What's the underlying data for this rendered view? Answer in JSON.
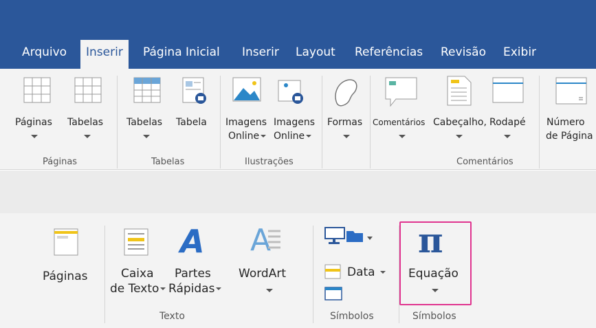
{
  "tabs": [
    {
      "label": "Arquivo",
      "active": false
    },
    {
      "label": "Inserir",
      "active": true
    },
    {
      "label": "Página Inicial",
      "active": false
    },
    {
      "label": "Inserir",
      "active": false
    },
    {
      "label": "Layout",
      "active": false
    },
    {
      "label": "Referências",
      "active": false
    },
    {
      "label": "Revisão",
      "active": false
    },
    {
      "label": "Exibir",
      "active": false
    }
  ],
  "ribbon1": {
    "buttons": [
      {
        "line1": "Páginas",
        "icon": "grid-icon"
      },
      {
        "line1": "Tabelas",
        "icon": "grid-icon"
      },
      {
        "line1": "Tabelas",
        "icon": "table-icon"
      },
      {
        "line1": "Tabela",
        "icon": "table-image-icon"
      },
      {
        "line1": "Imagens",
        "line2": "Online",
        "icon": "picture-icon"
      },
      {
        "line1": "Imagens",
        "line2": "Online",
        "icon": "online-picture-icon"
      },
      {
        "line1": "Formas",
        "icon": "shapes-icon"
      },
      {
        "line1": "Comentários",
        "icon": "comment-icon"
      },
      {
        "line1": "Cabeçalho,",
        "icon": "header-icon"
      },
      {
        "line1": "Rodapé",
        "icon": "footer-icon"
      },
      {
        "line1": "Número",
        "line2": "de Página",
        "icon": "page-number-icon"
      }
    ],
    "groups": [
      "Páginas",
      "Tabelas",
      "Ilustrações",
      "Comentários"
    ]
  },
  "ribbon2": {
    "buttons": [
      {
        "line1": "Páginas",
        "icon": "page-icon"
      },
      {
        "line1": "Caixa",
        "line2": "de Texto",
        "icon": "text-box-icon"
      },
      {
        "line1": "Partes",
        "line2": "Rápidas",
        "icon": "quick-parts-icon"
      },
      {
        "line1": "WordArt",
        "icon": "wordart-icon"
      },
      {
        "line1": "Data",
        "icon": "date-icon"
      },
      {
        "line1": "Equação",
        "icon": "pi-icon"
      }
    ],
    "groups": [
      "Texto",
      "Símbolos",
      "Símbolos"
    ],
    "highlight_color": "#e0348f"
  },
  "colors": {
    "tab_bar": "#2b579a",
    "ribbon": "#f3f3f3",
    "accent": "#2b579a"
  }
}
